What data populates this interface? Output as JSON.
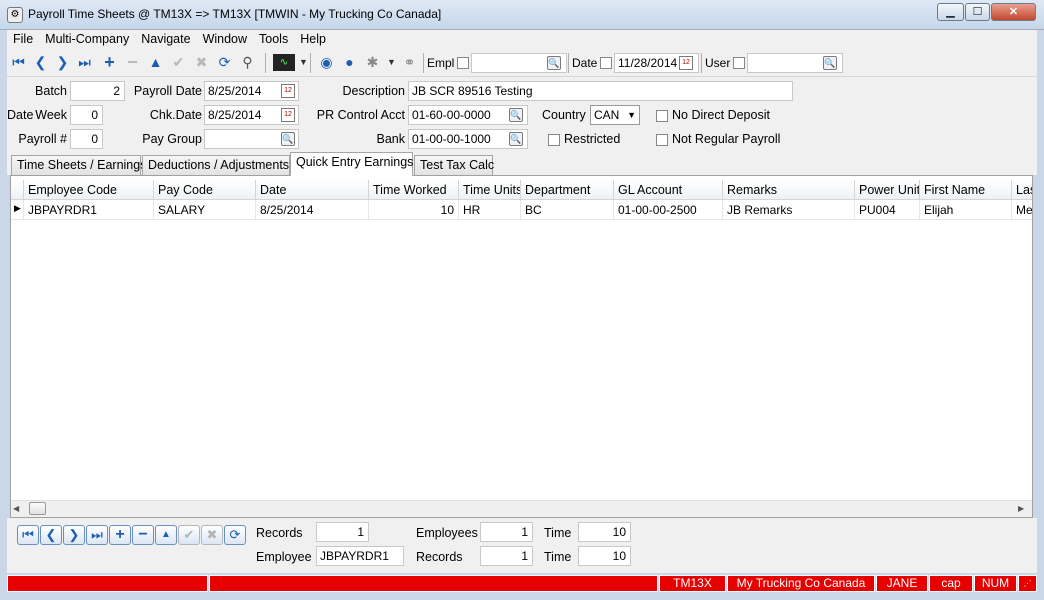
{
  "window": {
    "title": "Payroll Time Sheets @ TM13X => TM13X [TMWIN - My Trucking Co Canada]",
    "min": "▁",
    "max": "☐",
    "close": "✕"
  },
  "menu": [
    "File",
    "Multi-Company",
    "Navigate",
    "Window",
    "Tools",
    "Help"
  ],
  "toolbar": {
    "empl_label": "Empl",
    "date_label": "Date",
    "date_value": "11/28/2014",
    "user_label": "User",
    "empl_value": "",
    "user_value": ""
  },
  "form": {
    "batch_label": "Batch",
    "batch_value": "2",
    "date_label": "Date",
    "week_label": "Week",
    "week_value": "0",
    "payroll_num_label": "Payroll #",
    "payroll_num_value": "0",
    "payroll_date_label": "Payroll Date",
    "payroll_date_value": "8/25/2014",
    "chk_date_label": "Chk.Date",
    "chk_date_value": "8/25/2014",
    "pay_group_label": "Pay Group",
    "pay_group_value": "",
    "description_label": "Description",
    "description_value": "JB SCR 89516 Testing",
    "pr_control_label": "PR Control Acct",
    "pr_control_value": "01-60-00-0000",
    "bank_label": "Bank",
    "bank_value": "01-00-00-1000",
    "country_label": "Country",
    "country_value": "CAN",
    "restricted_label": "Restricted",
    "no_direct_label": "No Direct Deposit",
    "not_regular_label": "Not Regular Payroll"
  },
  "tabs": [
    "Time Sheets / Earnings",
    "Deductions / Adjustments",
    "Quick Entry Earnings",
    "Test Tax Calc"
  ],
  "active_tab": 2,
  "grid": {
    "columns": [
      "Employee Code",
      "Pay Code",
      "Date",
      "Time Worked",
      "Time Units",
      "Department",
      "GL Account",
      "Remarks",
      "Power Unit",
      "First Name",
      "Las"
    ],
    "rows": [
      [
        "JBPAYRDR1",
        "SALARY",
        "8/25/2014",
        "10",
        "HR",
        "BC",
        "01-00-00-2500",
        "JB Remarks",
        "PU004",
        "Elijah",
        "Me"
      ]
    ]
  },
  "summary": {
    "records_label": "Records",
    "records_value": "1",
    "employee_label": "Employee",
    "employee_value": "JBPAYRDR1",
    "employees_label": "Employees",
    "employees_value": "1",
    "records2_label": "Records",
    "records2_value": "1",
    "time_label": "Time",
    "time_value": "10",
    "time2_label": "Time",
    "time2_value": "10"
  },
  "status": {
    "company_code": "TM13X",
    "company_name": "My Trucking Co Canada",
    "user": "JANE",
    "cap": "cap",
    "num": "NUM"
  },
  "colors": {
    "status_red": "#e60000",
    "accent_blue": "#1a5fb4"
  }
}
